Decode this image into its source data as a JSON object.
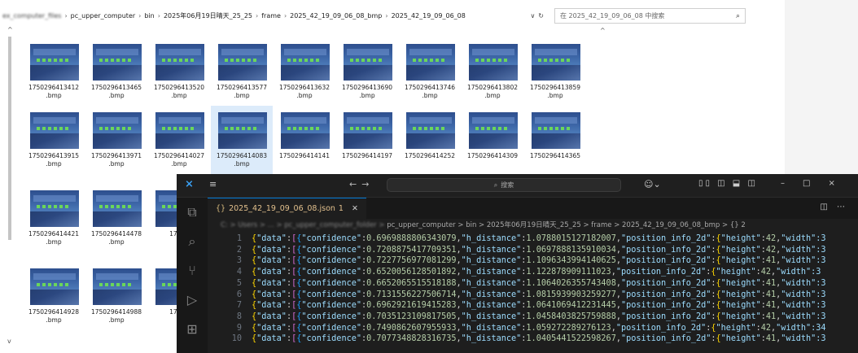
{
  "explorer": {
    "breadcrumb": [
      "pc_upper_computer",
      "bin",
      "2025年06月19日晴天_25_25",
      "frame",
      "2025_42_19_09_06_08_bmp",
      "2025_42_19_09_06_08"
    ],
    "breadcrumb_redacted": "ex_computer_files",
    "search_placeholder": "在 2025_42_19_09_06_08 中搜索",
    "files": [
      {
        "name1": "1750296413412",
        "name2": ".bmp"
      },
      {
        "name1": "1750296413465",
        "name2": ".bmp"
      },
      {
        "name1": "1750296413520",
        "name2": ".bmp"
      },
      {
        "name1": "1750296413577",
        "name2": ".bmp"
      },
      {
        "name1": "1750296413632",
        "name2": ".bmp"
      },
      {
        "name1": "1750296413690",
        "name2": ".bmp"
      },
      {
        "name1": "1750296413746",
        "name2": ".bmp"
      },
      {
        "name1": "1750296413802",
        "name2": ".bmp"
      },
      {
        "name1": "1750296413859",
        "name2": ".bmp"
      },
      {
        "name1": "1750296413915",
        "name2": ".bmp"
      },
      {
        "name1": "1750296413971",
        "name2": ".bmp"
      },
      {
        "name1": "1750296414027",
        "name2": ".bmp"
      },
      {
        "name1": "1750296414083",
        "name2": ".bmp"
      },
      {
        "name1": "1750296414141",
        "name2": ""
      },
      {
        "name1": "1750296414197",
        "name2": ""
      },
      {
        "name1": "1750296414252",
        "name2": ""
      },
      {
        "name1": "1750296414309",
        "name2": ""
      },
      {
        "name1": "1750296414365",
        "name2": ""
      },
      {
        "name1": "1750296414421",
        "name2": ".bmp"
      },
      {
        "name1": "1750296414478",
        "name2": ".bmp"
      },
      {
        "name1": "17502",
        "name2": ""
      },
      {
        "name1": "1750296414928",
        "name2": ".bmp"
      },
      {
        "name1": "1750296414988",
        "name2": ".bmp"
      },
      {
        "name1": "17502",
        "name2": ""
      }
    ]
  },
  "vscode": {
    "search_label": "搜索",
    "tab_label": "2025_42_19_09_06_08.json",
    "tab_badge": "1",
    "breadcrumb_redacted": "C: > Users > ... > pc_upper_computer_folder >",
    "breadcrumb": "pc_upper_computer > bin > 2025年06月19日晴天_25_25 > frame > 2025_42_19_09_06_08_bmp > {} 2",
    "lines": [
      {
        "num": "1",
        "confidence": "0.6969888806343079",
        "h_distance": "1.0788015127182007",
        "height": "42",
        "tail": "\"width\":3"
      },
      {
        "num": "2",
        "confidence": "0.7208875417709351",
        "h_distance": "1.0697888135910034",
        "height": "42",
        "tail": "\"width\":3"
      },
      {
        "num": "3",
        "confidence": "0.7227756977081299",
        "h_distance": "1.1096343994140625",
        "height": "41",
        "tail": "\"width\":3"
      },
      {
        "num": "4",
        "confidence": "0.6520056128501892",
        "h_distance": "1.122878909111023",
        "height": "42",
        "tail": "\"width\":3"
      },
      {
        "num": "5",
        "confidence": "0.6652065515518188",
        "h_distance": "1.1064026355743408",
        "height": "41",
        "tail": "\"width\":3"
      },
      {
        "num": "6",
        "confidence": "0.7131556227506714",
        "h_distance": "1.0815939903259277",
        "height": "41",
        "tail": "\"width\":3"
      },
      {
        "num": "7",
        "confidence": "0.6962921619415283",
        "h_distance": "1.0641069412231445",
        "height": "41",
        "tail": "\"width\":3"
      },
      {
        "num": "8",
        "confidence": "0.7035123109817505",
        "h_distance": "1.0458403825759888",
        "height": "41",
        "tail": "\"width\":3"
      },
      {
        "num": "9",
        "confidence": "0.7490862607955933",
        "h_distance": "1.059272289276123",
        "height": "42",
        "tail": "\"width\":34"
      },
      {
        "num": "10",
        "confidence": "0.7077348828316735",
        "h_distance": "1.0405441522598267",
        "height": "41",
        "tail": "\"width\":3"
      }
    ]
  }
}
